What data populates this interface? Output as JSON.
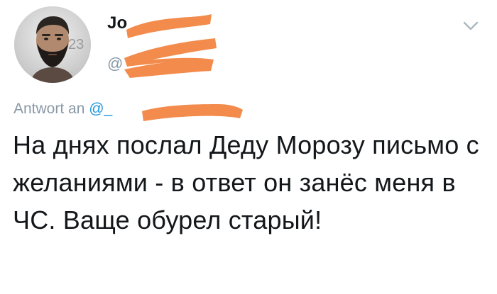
{
  "tweet": {
    "author": {
      "display_name": "Jo",
      "handle": "@",
      "avatar": "avatar-photo-bearded-man"
    },
    "reply_label": "Antwort an",
    "reply_mention": "@_",
    "text": "На днях послал Деду Морозу письмо с желаниями - в ответ он занёс меня в ЧС. Ваще обурел старый!",
    "menu_icon": "chevron-down-icon"
  },
  "colors": {
    "text_primary": "#14171a",
    "text_secondary": "#8899a6",
    "link": "#1b95e0",
    "redaction": "#f28b4b"
  }
}
